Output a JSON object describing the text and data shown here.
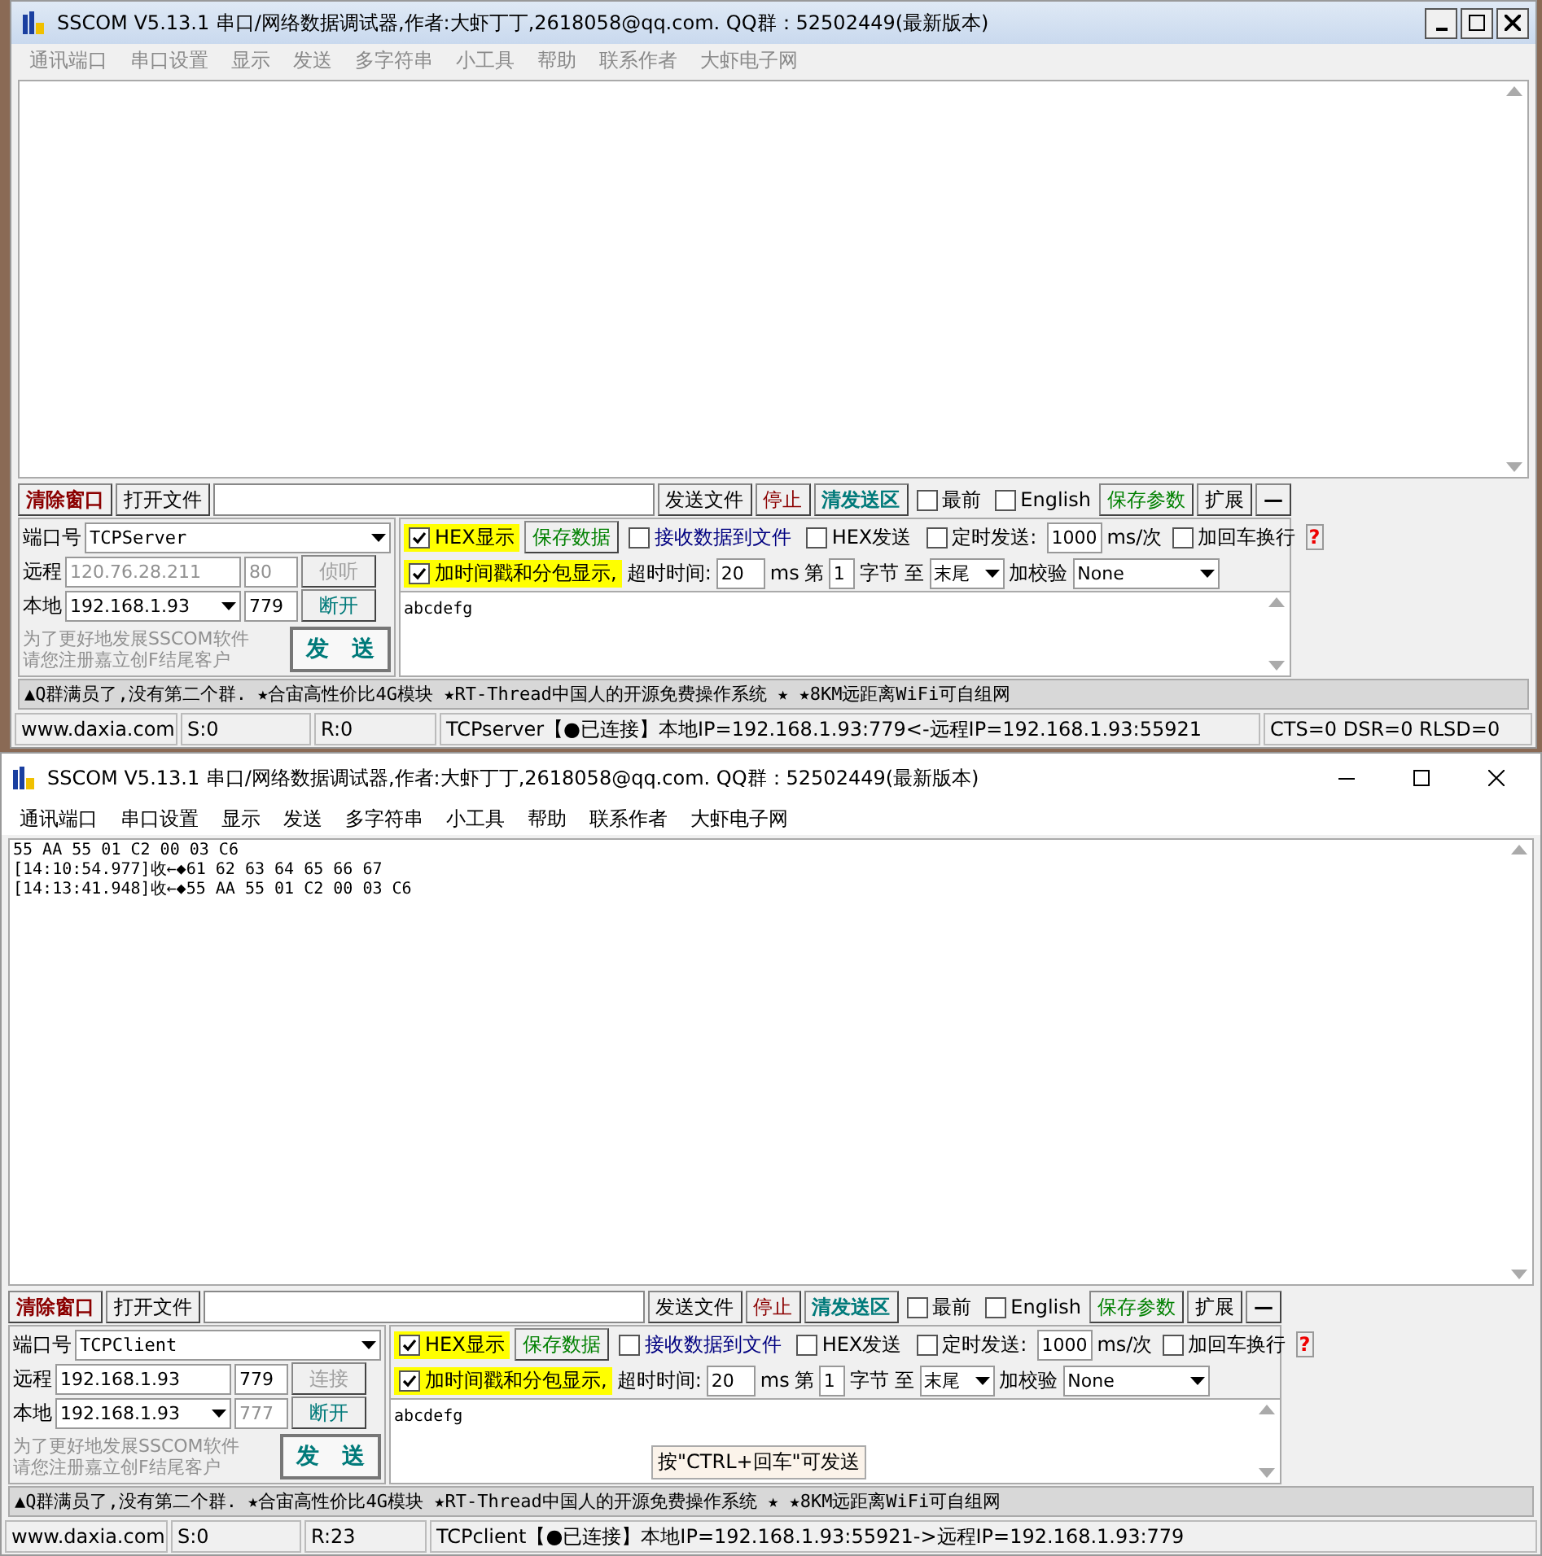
{
  "windows": [
    {
      "title": "SSCOM V5.13.1 串口/网络数据调试器,作者:大虾丁丁,2618058@qq.com. QQ群：52502449(最新版本)",
      "active": false,
      "menu": [
        "通讯端口",
        "串口设置",
        "显示",
        "发送",
        "多字符串",
        "小工具",
        "帮助",
        "联系作者",
        "大虾电子网"
      ],
      "toolbar": {
        "clear_button": "清除窗口",
        "open_file_button": "打开文件",
        "send_file_button": "发送文件",
        "stop_button": "停止",
        "clear_send_button": "清发送区",
        "checks": [
          {
            "label": "最前",
            "checked": false
          },
          {
            "label": "English",
            "checked": false
          }
        ],
        "save_params_button": "保存参数",
        "expand_button": "扩展",
        "collapse_button": "—"
      },
      "port_label": "端口号",
      "port_value": "TCPServer",
      "remote_label": "远程",
      "remote_ip": "120.76.28.211",
      "remote_port": "80",
      "remote_disabled": true,
      "connect_button": {
        "label": "侦听",
        "disabled": true
      },
      "local_label": "本地",
      "local_ip": "192.168.1.93",
      "local_port": "779",
      "local_port_disabled": false,
      "disconnect_button": "断开",
      "promo_lines": [
        "为了更好地发展SSCOM软件",
        "请您注册嘉立创F结尾客户"
      ],
      "send_button": "发　送",
      "hex_display": {
        "label": "HEX显示",
        "checked": true
      },
      "save_data_button": "保存数据",
      "recv_to_file": {
        "label": "接收数据到文件",
        "checked": false
      },
      "hex_send": {
        "label": "HEX发送",
        "checked": false
      },
      "timed_send": {
        "label": "定时发送:",
        "checked": false
      },
      "interval": "1000",
      "interval_unit": "ms/次",
      "add_crlf": {
        "label": "加回车换行",
        "checked": false
      },
      "help": "?",
      "timestamp": {
        "label": "加时间戳和分包显示,",
        "checked": true
      },
      "timeout_label": "超时时间:",
      "timeout": "20",
      "timeout_unit": "ms",
      "byte_from_label": "第",
      "byte_from": "1",
      "byte_to_label": "字节 至",
      "byte_to": "末尾",
      "checksum_label": "加校验",
      "checksum": "None",
      "send_text": "abcdefg",
      "ticker": "▲Q群满员了,没有第二个群. ★合宙高性价比4G模块 ★RT-Thread中国人的开源免费操作系统 ★ ★8KM远距离WiFi可自组网",
      "status": [
        "www.daxia.com",
        "S:0",
        "R:0",
        "TCPserver【●已连接】本地IP=192.168.1.93:779<-远程IP=192.168.1.93:55921",
        "CTS=0 DSR=0 RLSD=0"
      ]
    },
    {
      "title": "SSCOM V5.13.1 串口/网络数据调试器,作者:大虾丁丁,2618058@qq.com. QQ群：52502449(最新版本)",
      "active": true,
      "menu": [
        "通讯端口",
        "串口设置",
        "显示",
        "发送",
        "多字符串",
        "小工具",
        "帮助",
        "联系作者",
        "大虾电子网"
      ],
      "receive_lines": [
        "55 AA 55 01 C2 00 03 C6",
        "[14:10:54.977]收←◆61 62 63 64 65 66 67",
        "[14:13:41.948]收←◆55 AA 55 01 C2 00 03 C6"
      ],
      "toolbar": {
        "clear_button": "清除窗口",
        "open_file_button": "打开文件",
        "send_file_button": "发送文件",
        "stop_button": "停止",
        "clear_send_button": "清发送区",
        "checks": [
          {
            "label": "最前",
            "checked": false
          },
          {
            "label": "English",
            "checked": false
          }
        ],
        "save_params_button": "保存参数",
        "expand_button": "扩展",
        "collapse_button": "—"
      },
      "port_label": "端口号",
      "port_value": "TCPClient",
      "remote_label": "远程",
      "remote_ip": "192.168.1.93",
      "remote_port": "779",
      "remote_disabled": false,
      "connect_button": {
        "label": "连接",
        "disabled": true
      },
      "local_label": "本地",
      "local_ip": "192.168.1.93",
      "local_port": "777",
      "local_port_disabled": true,
      "disconnect_button": "断开",
      "promo_lines": [
        "为了更好地发展SSCOM软件",
        "请您注册嘉立创F结尾客户"
      ],
      "send_button": "发　送",
      "hex_display": {
        "label": "HEX显示",
        "checked": true
      },
      "save_data_button": "保存数据",
      "recv_to_file": {
        "label": "接收数据到文件",
        "checked": false
      },
      "hex_send": {
        "label": "HEX发送",
        "checked": false
      },
      "timed_send": {
        "label": "定时发送:",
        "checked": false
      },
      "interval": "1000",
      "interval_unit": "ms/次",
      "add_crlf": {
        "label": "加回车换行",
        "checked": false
      },
      "help": "?",
      "timestamp": {
        "label": "加时间戳和分包显示,",
        "checked": true
      },
      "timeout_label": "超时时间:",
      "timeout": "20",
      "timeout_unit": "ms",
      "byte_from_label": "第",
      "byte_from": "1",
      "byte_to_label": "字节 至",
      "byte_to": "末尾",
      "checksum_label": "加校验",
      "checksum": "None",
      "send_text": "abcdefg",
      "tooltip": "按\"CTRL+回车\"可发送",
      "ticker": "▲Q群满员了,没有第二个群. ★合宙高性价比4G模块 ★RT-Thread中国人的开源免费操作系统 ★ ★8KM远距离WiFi可自组网",
      "status": [
        "www.daxia.com",
        "S:0",
        "R:23",
        "TCPclient【●已连接】本地IP=192.168.1.93:55921->远程IP=192.168.1.93:779"
      ]
    }
  ]
}
